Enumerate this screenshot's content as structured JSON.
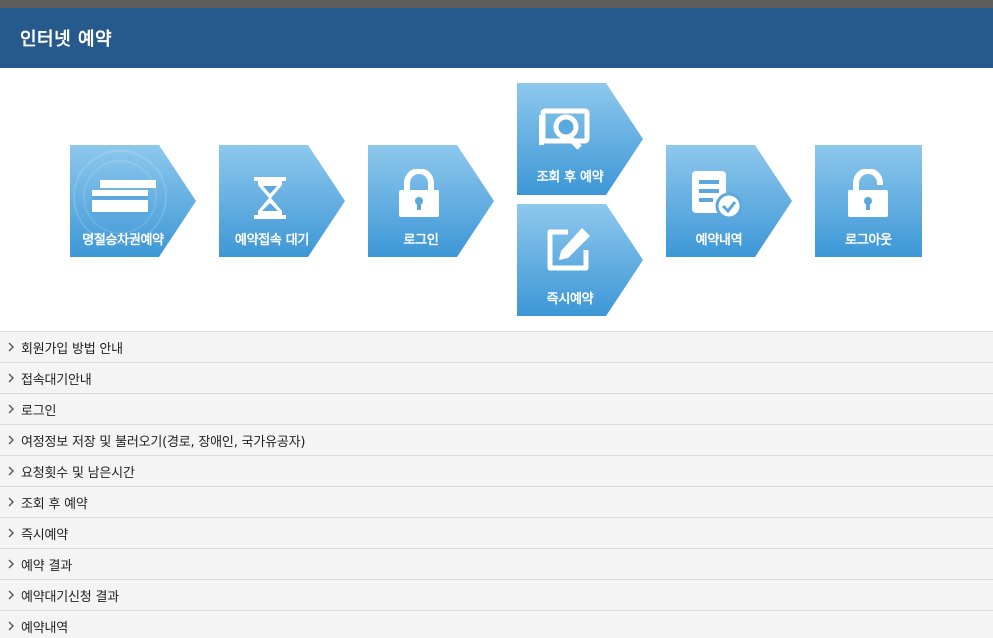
{
  "header": {
    "title": "인터넷 예약"
  },
  "steps": [
    {
      "label": "명절승차권예약",
      "icon": "tickets-icon"
    },
    {
      "label": "예약접속 대기",
      "icon": "hourglass-icon"
    },
    {
      "label": "로그인",
      "icon": "lock-icon"
    },
    {
      "label": "조회 후 예약",
      "icon": "search-document-icon"
    },
    {
      "label": "즉시예약",
      "icon": "edit-icon"
    },
    {
      "label": "예약내역",
      "icon": "checked-document-icon"
    },
    {
      "label": "로그아웃",
      "icon": "unlock-icon"
    }
  ],
  "colors": {
    "header": "#275a8c",
    "step_top": "#8ec8ed",
    "step_bottom": "#3d97d6"
  },
  "list_items": [
    "회원가입 방법 안내",
    "접속대기안내",
    "로그인",
    "여정정보 저장 및 불러오기(경로, 장애인, 국가유공자)",
    "요청횟수 및 남은시간",
    "조회 후 예약",
    "즉시예약",
    "예약 결과",
    "예약대기신청 결과",
    "예약내역"
  ]
}
